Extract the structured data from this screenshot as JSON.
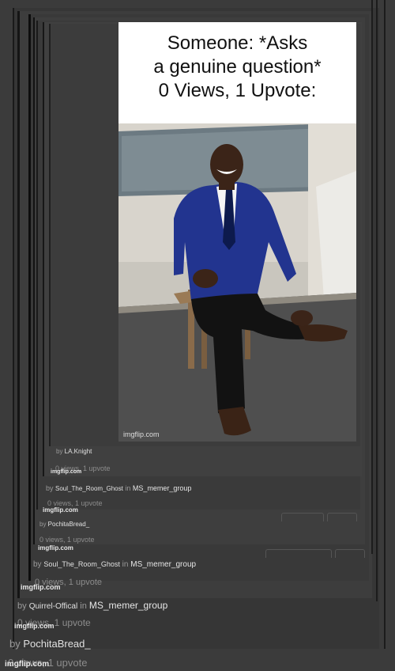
{
  "meme": {
    "caption_lines": [
      "Someone: *Asks",
      "a genuine question*",
      "0 Views, 1 Upvote:"
    ],
    "watermark": "imgflip.com"
  },
  "entries": [
    {
      "by": "by ",
      "user": "LA.Knight",
      "in_text": "",
      "group": "",
      "views": "0 views, 1 upvote",
      "watermark": "imgflip.com"
    },
    {
      "by": "by ",
      "user": "Soul_The_Room_Ghost",
      "in_text": " in ",
      "group": "MS_memer_group",
      "views": "0 views, 1 upvote",
      "watermark": "imgflip.com"
    },
    {
      "by": "by ",
      "user": "PochitaBread_",
      "in_text": "",
      "group": "",
      "views": "0 views, 1 upvote",
      "watermark": "imgflip.com"
    },
    {
      "by": "by ",
      "user": "Soul_The_Room_Ghost",
      "in_text": " in ",
      "group": "MS_memer_group",
      "views": "0 views, 1 upvote",
      "watermark": "imgflip.com"
    },
    {
      "by": "by ",
      "user": "Quirrel-Offical",
      "in_text": " in ",
      "group": "MS_memer_group",
      "views": "0 views, 1 upvote",
      "watermark": "imgflip.com"
    },
    {
      "by": "by ",
      "user": "PochitaBread_",
      "in_text": "",
      "group": "",
      "views": "0 views, 1 upvote",
      "watermark": "imgflip.com"
    }
  ],
  "colors": {
    "background": "#3a3a3a",
    "username": "#e0e0e0",
    "muted": "#9a9a9a",
    "suit": "#1e2f8a"
  }
}
